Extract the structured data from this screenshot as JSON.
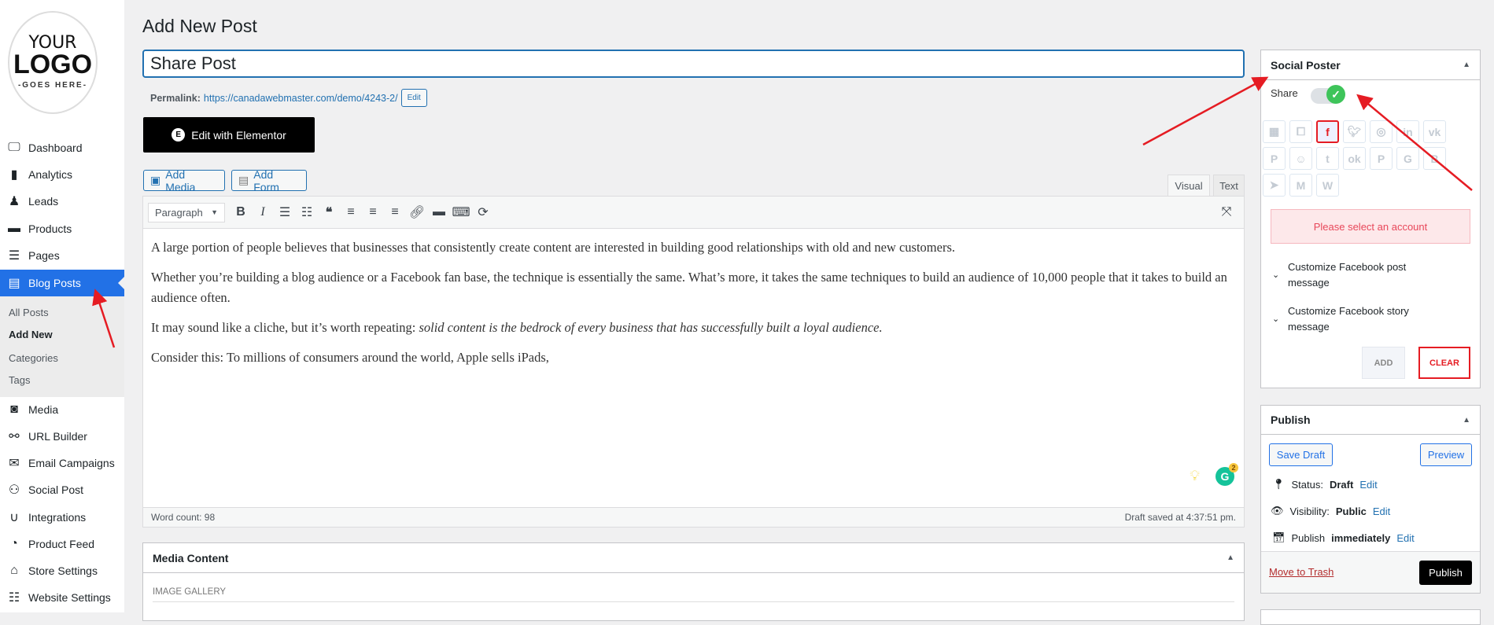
{
  "logo": {
    "line1": "YOUR",
    "line2": "LOGO",
    "line3": "-GOES HERE-"
  },
  "sidebar": {
    "items": [
      {
        "label": "Dashboard",
        "icon": "monitor-icon"
      },
      {
        "label": "Analytics",
        "icon": "bar-chart-icon"
      },
      {
        "label": "Leads",
        "icon": "person-pin-icon"
      },
      {
        "label": "Products",
        "icon": "archive-box-icon"
      },
      {
        "label": "Pages",
        "icon": "list-page-icon"
      },
      {
        "label": "Blog Posts",
        "icon": "blog-post-icon",
        "active": true
      },
      {
        "label": "Media",
        "icon": "media-icon"
      },
      {
        "label": "URL Builder",
        "icon": "link-icon"
      },
      {
        "label": "Email Campaigns",
        "icon": "envelope-icon"
      },
      {
        "label": "Social Post",
        "icon": "people-icon"
      },
      {
        "label": "Integrations",
        "icon": "magnet-icon"
      },
      {
        "label": "Product Feed",
        "icon": "rss-icon"
      },
      {
        "label": "Store Settings",
        "icon": "store-icon"
      },
      {
        "label": "Website Settings",
        "icon": "sliders-icon"
      }
    ],
    "submenu": [
      "All Posts",
      "Add New",
      "Categories",
      "Tags"
    ]
  },
  "header": {
    "title": "Add New Post"
  },
  "post": {
    "title": "Share Post",
    "permalink_label": "Permalink:",
    "permalink_url": "https://canadawebmaster.com/demo/4243-2/",
    "permalink_edit": "Edit",
    "elementor_label": "Edit with Elementor",
    "add_media": "Add Media",
    "add_form": "Add Form"
  },
  "editor": {
    "tabs": [
      "Visual",
      "Text"
    ],
    "format": "Paragraph",
    "paragraphs": [
      "A large portion of people believes that businesses that consistently create content are interested in building good relationships with old and new customers.",
      "Whether you’re building a blog audience or a Facebook fan base, the technique is essentially the same. What’s more, it takes the same techniques to build an audience of 10,000 people that it takes to build an audience often.",
      "It may sound like a cliche, but it’s worth repeating: ",
      "Consider this: To millions of consumers around the world, Apple sells iPads,"
    ],
    "italic": "solid content is the bedrock of every business that has successfully built a loyal audience.",
    "word_count": "Word count: 98",
    "draft_saved": "Draft saved at 4:37:51 pm.",
    "grammarly_badge": "2"
  },
  "media_content": {
    "title": "Media Content",
    "section": "IMAGE GALLERY"
  },
  "social_poster": {
    "title": "Social Poster",
    "share_label": "Share",
    "share_on": true,
    "networks": [
      "all",
      "instagram-stories",
      "facebook",
      "twitter",
      "instagram",
      "linkedin",
      "vk",
      "pinterest",
      "reddit",
      "tumblr",
      "odnoklassniki",
      "plurk",
      "google-business",
      "blogger",
      "telegram",
      "medium",
      "wordpress"
    ],
    "selected": "facebook",
    "alert": "Please select an account",
    "customize": [
      "Customize Facebook post message",
      "Customize Facebook story message"
    ],
    "add": "ADD",
    "clear": "CLEAR"
  },
  "publish": {
    "title": "Publish",
    "save_draft": "Save Draft",
    "preview": "Preview",
    "status_label": "Status:",
    "status": "Draft",
    "visibility_label": "Visibility:",
    "visibility": "Public",
    "publish_label": "Publish",
    "publish_when": "immediately",
    "edit": "Edit",
    "trash": "Move to Trash",
    "publish_button": "Publish"
  },
  "colors": {
    "accent": "#2271e6",
    "link": "#2271b1",
    "danger": "#e51c23",
    "toggle_on": "#3ec45a"
  }
}
